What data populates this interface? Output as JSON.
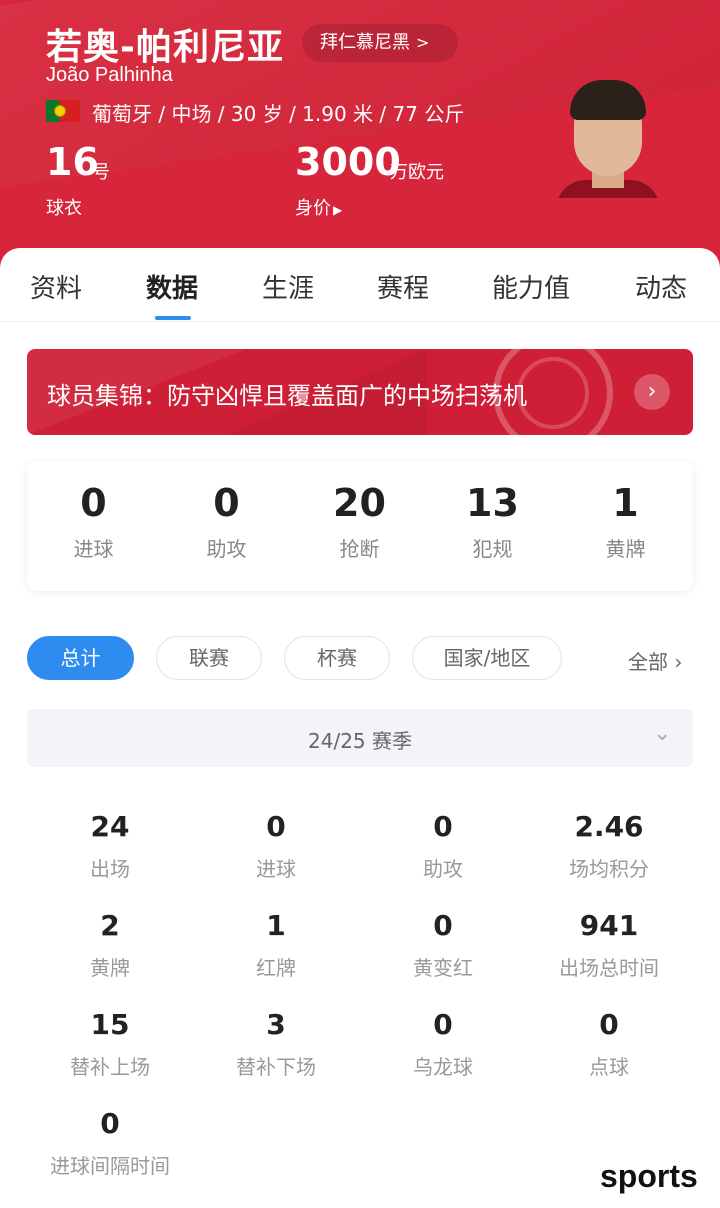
{
  "player": {
    "name": "若奥-帕利尼亚",
    "club": "拜仁慕尼黑",
    "club_chevron": ">",
    "latin_name": "João Palhinha",
    "bio": "葡萄牙 / 中场 / 30 岁 / 1.90 米 / 77 公斤",
    "jersey_number": "16",
    "jersey_unit": "号",
    "jersey_label": "球衣",
    "market_value": "3000",
    "market_value_unit": "万欧元",
    "market_value_label": "身价"
  },
  "tabs": [
    {
      "label": "资料"
    },
    {
      "label": "数据"
    },
    {
      "label": "生涯"
    },
    {
      "label": "赛程"
    },
    {
      "label": "能力值"
    },
    {
      "label": "动态"
    }
  ],
  "active_tab": "数据",
  "banner": {
    "text": "球员集锦：防守凶悍且覆盖面广的中场扫荡机"
  },
  "summary": [
    {
      "value": "0",
      "label": "进球"
    },
    {
      "value": "0",
      "label": "助攻"
    },
    {
      "value": "20",
      "label": "抢断"
    },
    {
      "value": "13",
      "label": "犯规"
    },
    {
      "value": "1",
      "label": "黄牌"
    }
  ],
  "filters": [
    {
      "label": "总计"
    },
    {
      "label": "联赛"
    },
    {
      "label": "杯赛"
    },
    {
      "label": "国家/地区"
    }
  ],
  "filter_all": "全部 ›",
  "season": "24/25 赛季",
  "stats": [
    {
      "value": "24",
      "label": "出场"
    },
    {
      "value": "0",
      "label": "进球"
    },
    {
      "value": "0",
      "label": "助攻"
    },
    {
      "value": "2.46",
      "label": "场均积分"
    },
    {
      "value": "2",
      "label": "黄牌"
    },
    {
      "value": "1",
      "label": "红牌"
    },
    {
      "value": "0",
      "label": "黄变红"
    },
    {
      "value": "941",
      "label": "出场总时间"
    },
    {
      "value": "15",
      "label": "替补上场"
    },
    {
      "value": "3",
      "label": "替补下场"
    },
    {
      "value": "0",
      "label": "乌龙球"
    },
    {
      "value": "0",
      "label": "点球"
    },
    {
      "value": "0",
      "label": "进球间隔时间"
    }
  ],
  "watermark": "sports",
  "colors": {
    "header_red": "#d7263b",
    "accent_blue": "#2e8cf0"
  }
}
